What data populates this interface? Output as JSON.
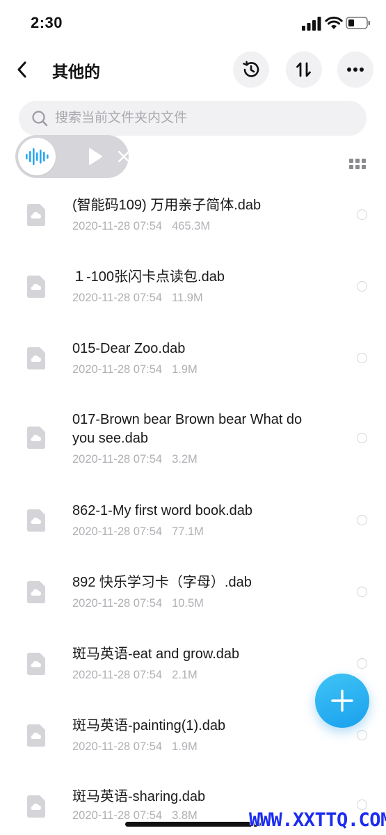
{
  "status": {
    "time": "2:30"
  },
  "header": {
    "title": "其他的"
  },
  "search": {
    "placeholder": "搜索当前文件夹内文件"
  },
  "files": [
    {
      "name": "(智能码109) 万用亲子简体.dab",
      "date": "2020-11-28 07:54",
      "size": "465.3M"
    },
    {
      "name": "１-100张闪卡点读包.dab",
      "date": "2020-11-28 07:54",
      "size": "11.9M"
    },
    {
      "name": "015-Dear Zoo.dab",
      "date": "2020-11-28 07:54",
      "size": "1.9M"
    },
    {
      "name": "017-Brown bear Brown bear What do you see.dab",
      "date": "2020-11-28 07:54",
      "size": "3.2M"
    },
    {
      "name": "862-1-My first word book.dab",
      "date": "2020-11-28 07:54",
      "size": "77.1M"
    },
    {
      "name": "892 快乐学习卡（字母）.dab",
      "date": "2020-11-28 07:54",
      "size": "10.5M"
    },
    {
      "name": "斑马英语-eat and grow.dab",
      "date": "2020-11-28 07:54",
      "size": "2.1M"
    },
    {
      "name": "斑马英语-painting(1).dab",
      "date": "2020-11-28 07:54",
      "size": "1.9M"
    },
    {
      "name": "斑马英语-sharing.dab",
      "date": "2020-11-28 07:54",
      "size": "3.8M"
    }
  ],
  "watermark": "WWW.XXTTQ.COM",
  "colors": {
    "accent": "#1aa0ee",
    "wave": "#2aa6f0",
    "muted": "#b0b0b5"
  },
  "icons": [
    "back-icon",
    "history-icon",
    "sort-icon",
    "more-icon",
    "search-icon",
    "waveform-icon",
    "play-icon",
    "close-icon",
    "grid-icon",
    "file-icon",
    "plus-icon"
  ]
}
